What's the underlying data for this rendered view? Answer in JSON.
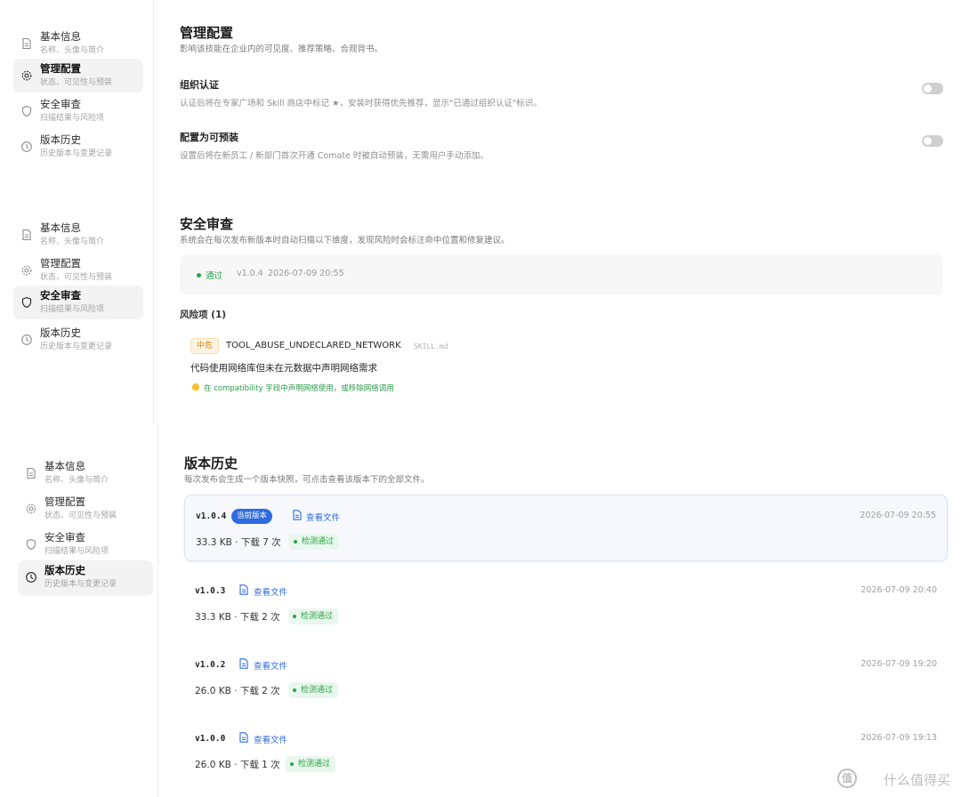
{
  "nav": [
    {
      "title": "基本信息",
      "sub": "名称、头像与简介",
      "icon": "document-icon"
    },
    {
      "title": "管理配置",
      "sub": "状态、可见性与预装",
      "icon": "gear-icon"
    },
    {
      "title": "安全审查",
      "sub": "扫描结果与风险项",
      "icon": "shield-icon"
    },
    {
      "title": "版本历史",
      "sub": "历史版本与变更记录",
      "icon": "clock-icon"
    }
  ],
  "config": {
    "title": "管理配置",
    "subtitle": "影响该技能在企业内的可见度、推荐策略、合规背书。",
    "org_cert": {
      "title": "组织认证",
      "desc": "认证后将在专家广场和 Skill 商店中标记 ★，安装时获得优先推荐，显示\"已通过组织认证\"标识。",
      "enabled": false
    },
    "preinstall": {
      "title": "配置为可预装",
      "desc": "设置后将在新员工 / 新部门首次开通 Comate 时被自动预装，无需用户手动添加。",
      "enabled": false
    }
  },
  "security": {
    "title": "安全审查",
    "subtitle": "系统会在每次发布新版本时自动扫描以下维度，发现风险时会标注命中位置和修复建议。",
    "scan": {
      "status": "通过",
      "version": "v1.0.4",
      "time": "2026-07-09 20:55"
    },
    "risk_title": "风险项 (1)",
    "risk": {
      "level": "中危",
      "code": "TOOL_ABUSE_UNDECLARED_NETWORK",
      "file": "SKILL.md",
      "desc": "代码使用网络库但未在元数据中声明网络需求",
      "hint": "在 compatibility 字段中声明网络使用，或移除网络调用"
    }
  },
  "history": {
    "title": "版本历史",
    "subtitle": "每次发布会生成一个版本快照，可点击查看该版本下的全部文件。",
    "view_label": "查看文件",
    "current_label": "当前版本",
    "versions": [
      {
        "version": "v1.0.4",
        "current": true,
        "time": "2026-07-09 20:55",
        "meta": "33.3 KB · 下载 7 次",
        "status": "检测通过"
      },
      {
        "version": "v1.0.3",
        "current": false,
        "time": "2026-07-09 20:40",
        "meta": "33.3 KB · 下载 2 次",
        "status": "检测通过"
      },
      {
        "version": "v1.0.2",
        "current": false,
        "time": "2026-07-09 19:20",
        "meta": "26.0 KB · 下载 2 次",
        "status": "检测通过"
      },
      {
        "version": "v1.0.0",
        "current": false,
        "time": "2026-07-09 19:13",
        "meta": "26.0 KB · 下载 1 次",
        "status": "检测通过"
      }
    ]
  },
  "watermark": {
    "logo": "值",
    "text": "什么值得买"
  },
  "colors": {
    "accent": "#2f6be0",
    "success": "#27a745",
    "warning": "#d08b16"
  }
}
